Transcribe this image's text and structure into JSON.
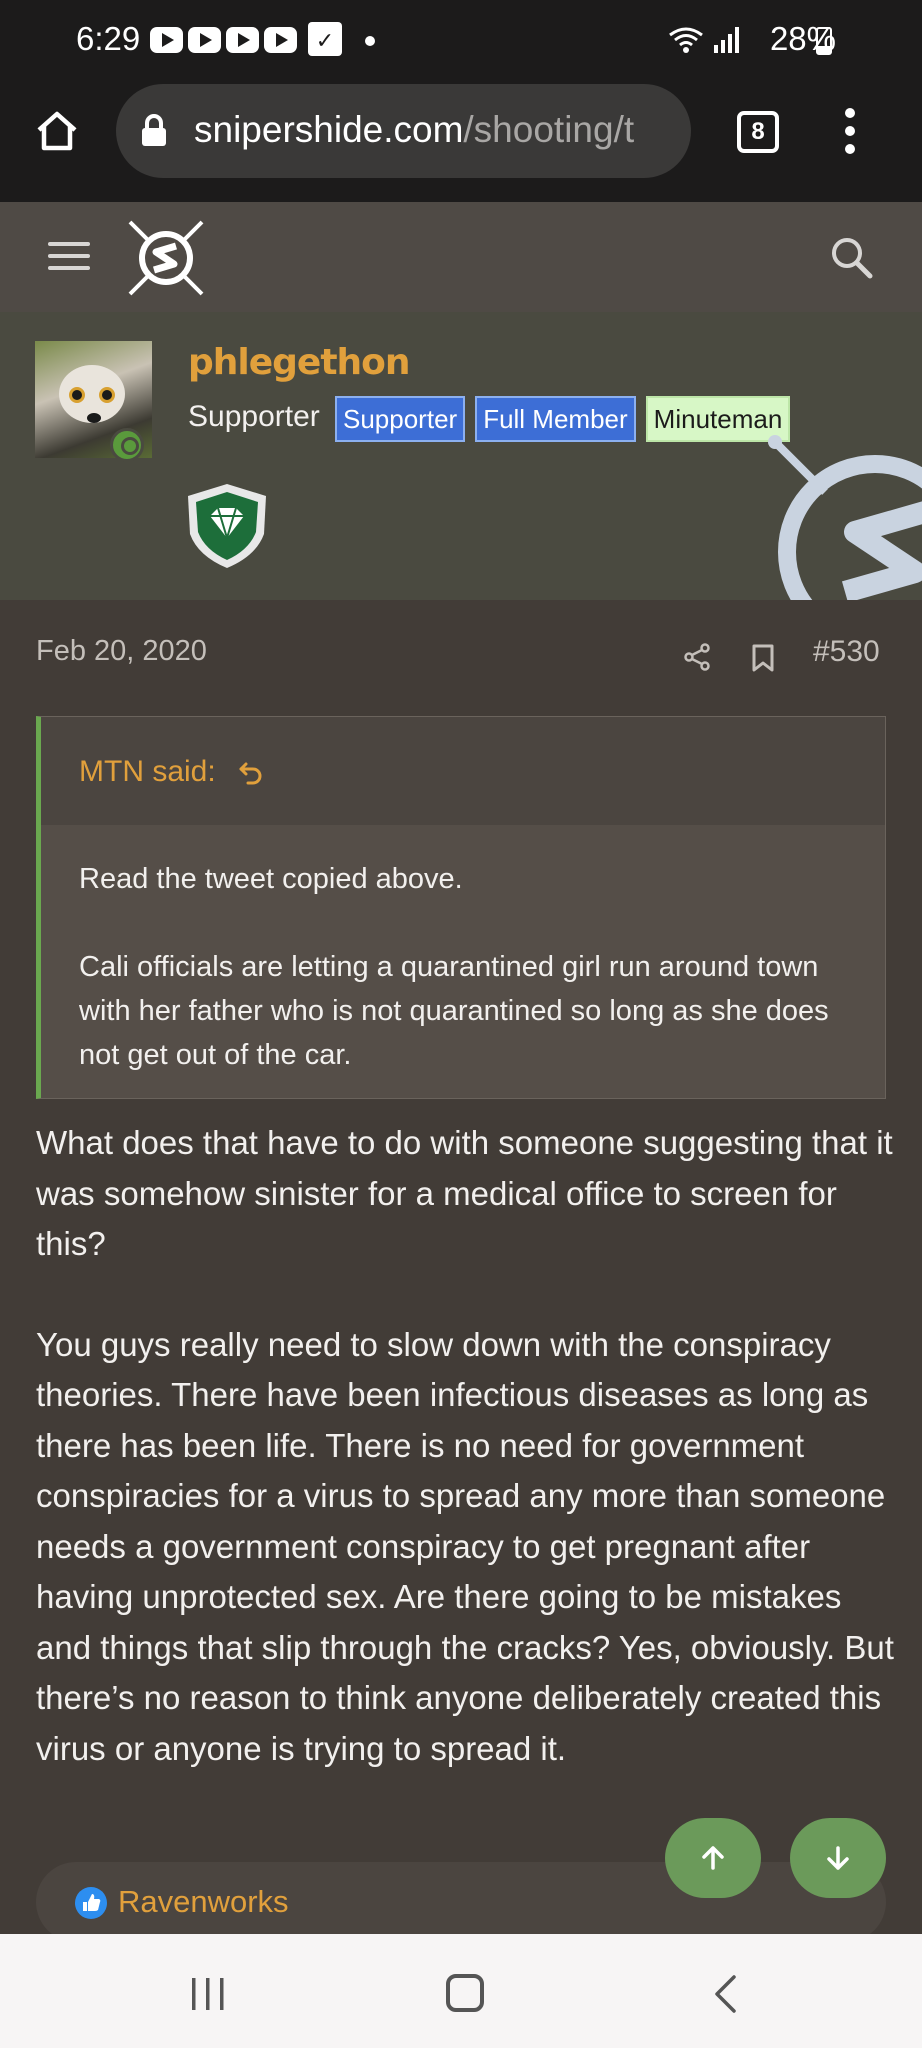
{
  "status_bar": {
    "time": "6:29",
    "battery": "28%",
    "icons": [
      "youtube-icon",
      "youtube-icon",
      "youtube-icon",
      "youtube-icon",
      "calendar-check-icon",
      "wifi-icon",
      "signal-icon",
      "battery-charging-icon"
    ]
  },
  "browser": {
    "url_host": "snipershide.com",
    "url_path": "/shooting/t",
    "tab_count": "8"
  },
  "profile": {
    "username": "phlegethon",
    "title": "Supporter",
    "badges": [
      "Supporter",
      "Full Member",
      "Minuteman"
    ]
  },
  "post": {
    "date": "Feb 20, 2020",
    "number": "#530",
    "quote_author": "MTN said:",
    "quote_paragraphs": [
      "Read the tweet copied above.",
      "Cali officials are letting a quarantined girl run around town with her father who is not quarantined so long as she does not get out of the car."
    ],
    "paragraphs": [
      "What does that have to do with someone suggesting that it was somehow sinister for a medical office to screen for this?",
      "You guys really need to slow down with the conspiracy theories. There have been infectious diseases as long as there has been life. There is no need for government conspiracies for a virus to spread any more than someone needs a government conspiracy to get pregnant after having unprotected sex. Are there going to be mistakes and things that slip through the cracks? Yes, obviously. But there’s no reason to think anyone deliberately created this virus or anyone is trying to spread it."
    ],
    "reaction_user": "Ravenworks"
  },
  "colors": {
    "accent": "#e1a03c",
    "badge_blue": "#3d6ed6",
    "badge_green": "#d7f7c6",
    "quote_border": "#6aa84f",
    "page_bg": "#423c37"
  }
}
